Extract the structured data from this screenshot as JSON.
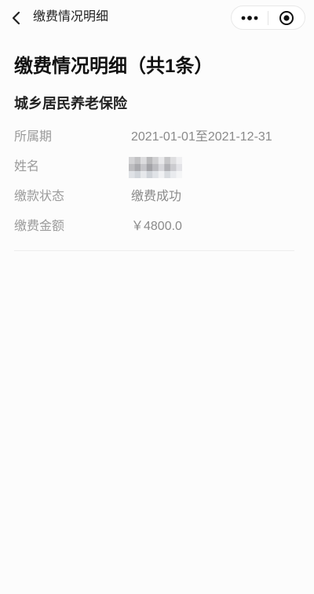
{
  "theme": {
    "background": "#fcfcfc",
    "title": "#111111",
    "label": "#9b9b9b",
    "value": "#8a8a8a",
    "divider": "#ededed"
  },
  "nav": {
    "title": "缴费情况明细",
    "back_icon": "chevron-left-icon",
    "more_icon": "more-dots-icon",
    "close_icon": "target-circle-icon"
  },
  "header": {
    "title": "缴费情况明细（共1条）"
  },
  "record": {
    "category": "城乡居民养老保险",
    "fields": [
      {
        "label": "所属期",
        "value": "2021-01-01至2021-12-31"
      },
      {
        "label": "姓名"
      },
      {
        "label": "缴款状态",
        "value": "缴费成功"
      },
      {
        "label": "缴费金额",
        "value": "￥4800.0"
      }
    ]
  }
}
